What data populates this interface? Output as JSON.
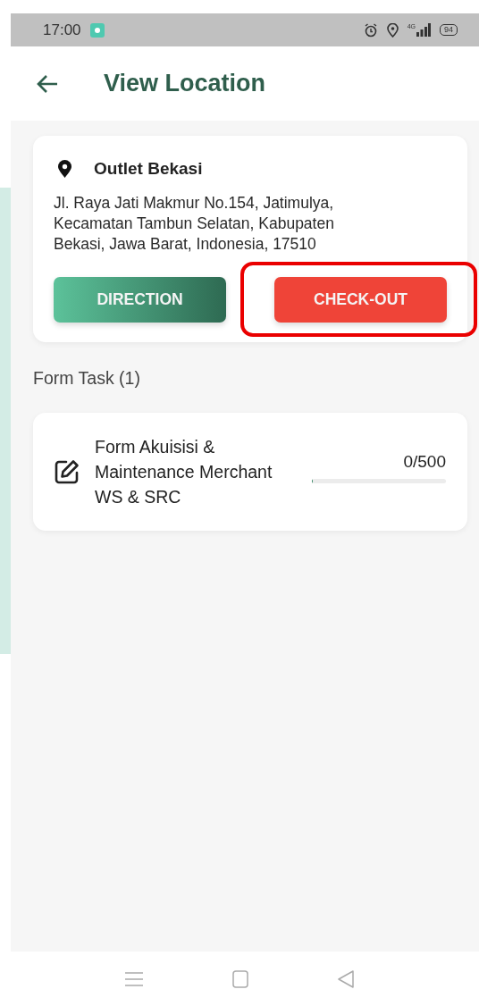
{
  "status_bar": {
    "time": "17:00",
    "network": "4G",
    "battery": "94"
  },
  "header": {
    "title": "View Location"
  },
  "location": {
    "name": "Outlet Bekasi",
    "address": "Jl. Raya Jati Makmur No.154, Jatimulya, Kecamatan Tambun Selatan, Kabupaten Bekasi, Jawa Barat, Indonesia, 17510",
    "buttons": [
      {
        "kind": "direction",
        "label": "DIRECTION",
        "highlighted": false
      },
      {
        "kind": "checkout",
        "label": "CHECK-OUT",
        "highlighted": true
      }
    ]
  },
  "form_task": {
    "heading": "Form Task (1)",
    "items": [
      {
        "title": "Form Akuisisi & Maintenance Merchant WS & SRC",
        "count": "0/500",
        "level": 0
      }
    ]
  }
}
